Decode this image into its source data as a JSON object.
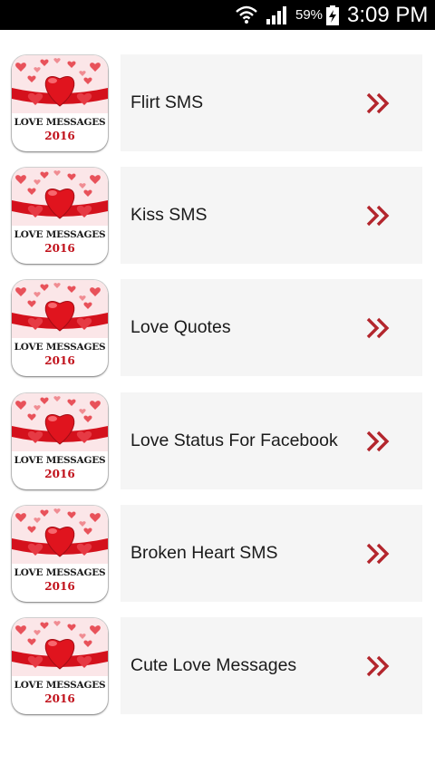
{
  "status_bar": {
    "battery_percent": "59%",
    "time": "3:09 PM",
    "icons": [
      "wifi-icon",
      "signal-icon",
      "battery-charging-icon"
    ]
  },
  "thumbnail": {
    "title": "LOVE MESSAGES",
    "year": "2016",
    "accent_color": "#e0141e"
  },
  "menu": {
    "items": [
      {
        "label": "Flirt SMS"
      },
      {
        "label": "Kiss SMS"
      },
      {
        "label": "Love Quotes"
      },
      {
        "label": "Love Status For Facebook"
      },
      {
        "label": "Broken Heart SMS"
      },
      {
        "label": "Cute Love Messages"
      }
    ],
    "chevron_icon": "double-chevron-right-icon",
    "chevron_color": "#b3262d",
    "card_background": "#f5f5f5"
  }
}
